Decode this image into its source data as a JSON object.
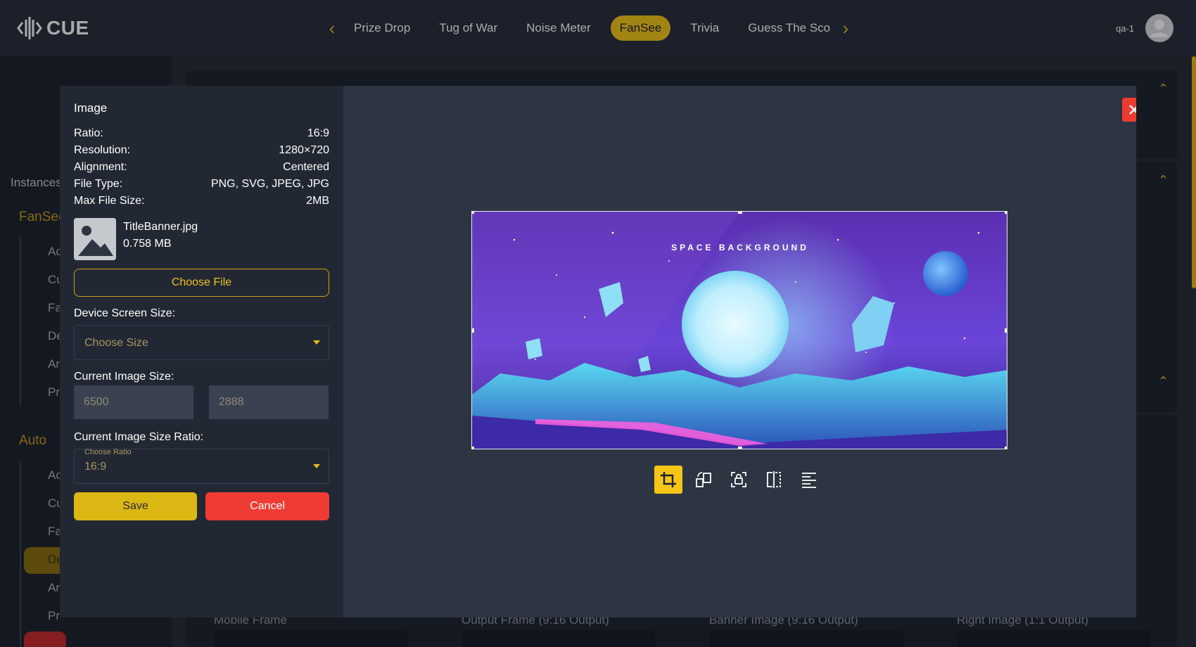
{
  "app": {
    "logo_text": "CUE",
    "user_name": "qa-1"
  },
  "nav": {
    "tabs": [
      {
        "label": "Prize Drop"
      },
      {
        "label": "Tug of War"
      },
      {
        "label": "Noise Meter"
      },
      {
        "label": "FanSee",
        "active": true
      },
      {
        "label": "Trivia"
      },
      {
        "label": "Guess The Sco"
      }
    ]
  },
  "background": {
    "sidebar": {
      "instances_label": "Instances",
      "group1_title": "FanSee",
      "group1_items": [
        "Ac",
        "Cu",
        "Fa",
        "De",
        "Ar",
        "Pr"
      ],
      "group2_title": "Auto",
      "group2_items": [
        "Ac",
        "Cu",
        "Fa",
        "De",
        "Ar",
        "Pr"
      ]
    },
    "cards": [
      "Mobile Frame",
      "Output Frame (9:16 Output)",
      "Banner Image (9:16 Output)",
      "Right Image (1:1 Output)"
    ]
  },
  "modal": {
    "title": "Image",
    "info": [
      {
        "label": "Ratio:",
        "value": "16:9"
      },
      {
        "label": "Resolution:",
        "value": "1280×720"
      },
      {
        "label": "Alignment:",
        "value": "Centered"
      },
      {
        "label": "File Type:",
        "value": "PNG, SVG, JPEG, JPG"
      },
      {
        "label": "Max File Size:",
        "value": "2MB"
      }
    ],
    "file": {
      "name": "TitleBanner.jpg",
      "size": "0.758 MB"
    },
    "choose_file_label": "Choose File",
    "device_size": {
      "label": "Device Screen Size:",
      "placeholder": "Choose Size"
    },
    "current_size": {
      "label": "Current Image Size:",
      "width": "6500",
      "height": "2888"
    },
    "ratio": {
      "label": "Current Image Size Ratio:",
      "float_label": "Choose Ratio",
      "value": "16:9"
    },
    "save_label": "Save",
    "cancel_label": "Cancel",
    "canvas_title": "SPACE BACKGROUND",
    "tools": [
      {
        "icon": "crop-icon",
        "active": true
      },
      {
        "icon": "rotate-icon",
        "active": false
      },
      {
        "icon": "lock-aspect-icon",
        "active": false
      },
      {
        "icon": "flip-icon",
        "active": false
      },
      {
        "icon": "align-icon",
        "active": false
      }
    ]
  },
  "colors": {
    "accent": "#f5c518",
    "danger": "#ef3b34",
    "background": "#1b1f29",
    "modal": "#2d3442"
  }
}
